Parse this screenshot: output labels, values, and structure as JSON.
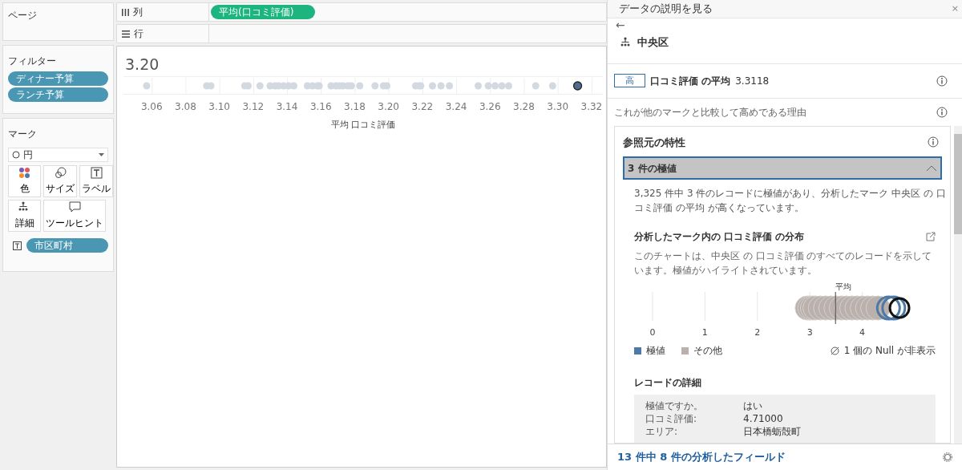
{
  "pages_panel": {
    "title": "ページ"
  },
  "filters_panel": {
    "title": "フィルター",
    "pills": [
      "ディナー予算",
      "ランチ予算"
    ]
  },
  "marks_panel": {
    "title": "マーク",
    "mark_type": "円",
    "buttons": [
      {
        "kind": "color",
        "label": "色"
      },
      {
        "kind": "size",
        "label": "サイズ"
      },
      {
        "kind": "label",
        "label": "ラベル"
      },
      {
        "kind": "detail",
        "label": "詳細"
      },
      {
        "kind": "tooltip",
        "label": "ツールヒント"
      }
    ],
    "fields": [
      {
        "kind": "label",
        "label": "市区町村"
      }
    ]
  },
  "shelves": [
    {
      "kind": "columns",
      "label": "列",
      "pills": [
        "平均(口コミ評価)"
      ]
    },
    {
      "kind": "rows",
      "label": "行"
    }
  ],
  "view": {
    "header": "3.20",
    "axis_ticks": [
      "3.06",
      "3.08",
      "3.10",
      "3.12",
      "3.14",
      "3.16",
      "3.18",
      "3.20",
      "3.22",
      "3.24",
      "3.26",
      "3.28",
      "3.30",
      "3.32"
    ],
    "axis_title": "平均 口コミ評価"
  },
  "explain_panel": {
    "title": "データの説明を見る",
    "close": "×",
    "back": "←",
    "mark": "中央区",
    "summary": {
      "badge": "高",
      "measure": "口コミ評価 の平均",
      "value": "3.3118"
    },
    "reason": "これが他のマークと比較して高めである理由",
    "section": {
      "title": "参照元の特性",
      "accordion": {
        "title": "3 件の極値",
        "expanded": true,
        "description": "3,325 件中 3 件のレコードに極値があり、分析したマーク 中央区 の 口コミ評価 の平均 が高くなっています。",
        "chart_title": "分析したマーク内の 口コミ評価 の分布",
        "chart_caption": "このチャートは、中央区 の 口コミ評価 のすべてのレコードを示しています。極値がハイライトされています。",
        "axis_ticks": [
          "0",
          "1",
          "2",
          "3",
          "4"
        ],
        "mean_label": "平均",
        "legend": [
          {
            "label": "極値",
            "color": "#4e79a7"
          },
          {
            "label": "その他",
            "color": "#bab0ac"
          }
        ],
        "null_note": "1 個の Null が非表示",
        "details_title": "レコードの詳細",
        "details": [
          {
            "field": "極値ですか。",
            "value": "はい"
          },
          {
            "field": "口コミ評価:",
            "value": "4.71000"
          },
          {
            "field": "エリア:",
            "value": "日本橋蛎殻町"
          }
        ]
      }
    },
    "footer": "13 件中 8 件の分析したフィールド"
  }
}
